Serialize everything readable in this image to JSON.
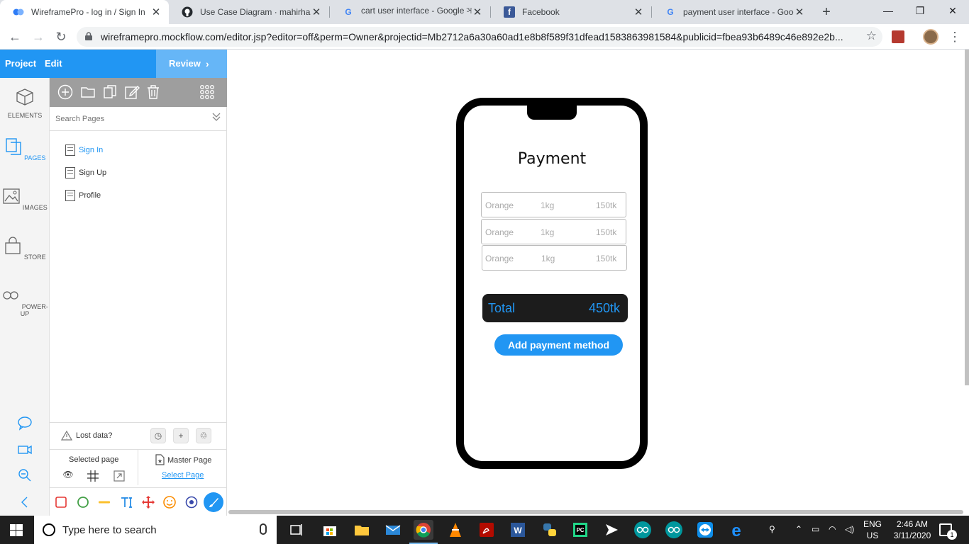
{
  "browser": {
    "tabs": [
      {
        "title": "WireframePro - log in / Sign In",
        "icon": "wireframepro-icon"
      },
      {
        "title": "Use Case Diagram · mahirhasa",
        "icon": "github-icon"
      },
      {
        "title": "cart user interface - Google সা",
        "icon": "google-icon"
      },
      {
        "title": "Facebook",
        "icon": "facebook-icon"
      },
      {
        "title": "payment user interface - Goog",
        "icon": "google-icon"
      }
    ],
    "tab_close": "✕",
    "new_tab": "+",
    "window_controls": {
      "minimize": "—",
      "maximize": "❐",
      "close": "✕"
    },
    "nav": {
      "back": "←",
      "forward": "→",
      "reload": "↻"
    },
    "url": "wireframepro.mockflow.com/editor.jsp?editor=off&perm=Owner&projectid=Mb2712a6a30a60ad1e8b8f589f31dfead1583863981584&publicid=fbea93b6489c46e892e2b...",
    "bookmark_star": "☆",
    "menu_dots": "⋮"
  },
  "app": {
    "menu": {
      "project": "Project",
      "edit": "Edit"
    },
    "review": "Review",
    "review_chevron": "›",
    "accent": "#2196f3",
    "rail": [
      {
        "label": "ELEMENTS",
        "icon": "cube-icon"
      },
      {
        "label": "PAGES",
        "icon": "pages-icon"
      },
      {
        "label": "IMAGES",
        "icon": "image-icon"
      },
      {
        "label": "STORE",
        "icon": "bag-icon"
      },
      {
        "label": "POWER-UP",
        "icon": "infinity-icon"
      }
    ],
    "search_pages_placeholder": "Search Pages",
    "pages": [
      "Sign In",
      "Sign Up",
      "Profile"
    ],
    "active_page": "Sign In",
    "lost_data": "Lost data?",
    "selected_page": "Selected page",
    "master_page": "Master Page",
    "select_page": "Select Page"
  },
  "canvas": {
    "title": "Payment",
    "items": [
      {
        "name": "Orange",
        "qty": "1kg",
        "price": "150tk"
      },
      {
        "name": "Orange",
        "qty": "1kg",
        "price": "150tk"
      },
      {
        "name": "Orange",
        "qty": "1kg",
        "price": "150tk"
      }
    ],
    "total_label": "Total",
    "total_value": "450tk",
    "button": "Add payment method"
  },
  "taskbar": {
    "search_placeholder": "Type here to search",
    "lang_top": "ENG",
    "lang_bottom": "US",
    "time": "2:46 AM",
    "date": "3/11/2020",
    "notification_count": "1"
  }
}
